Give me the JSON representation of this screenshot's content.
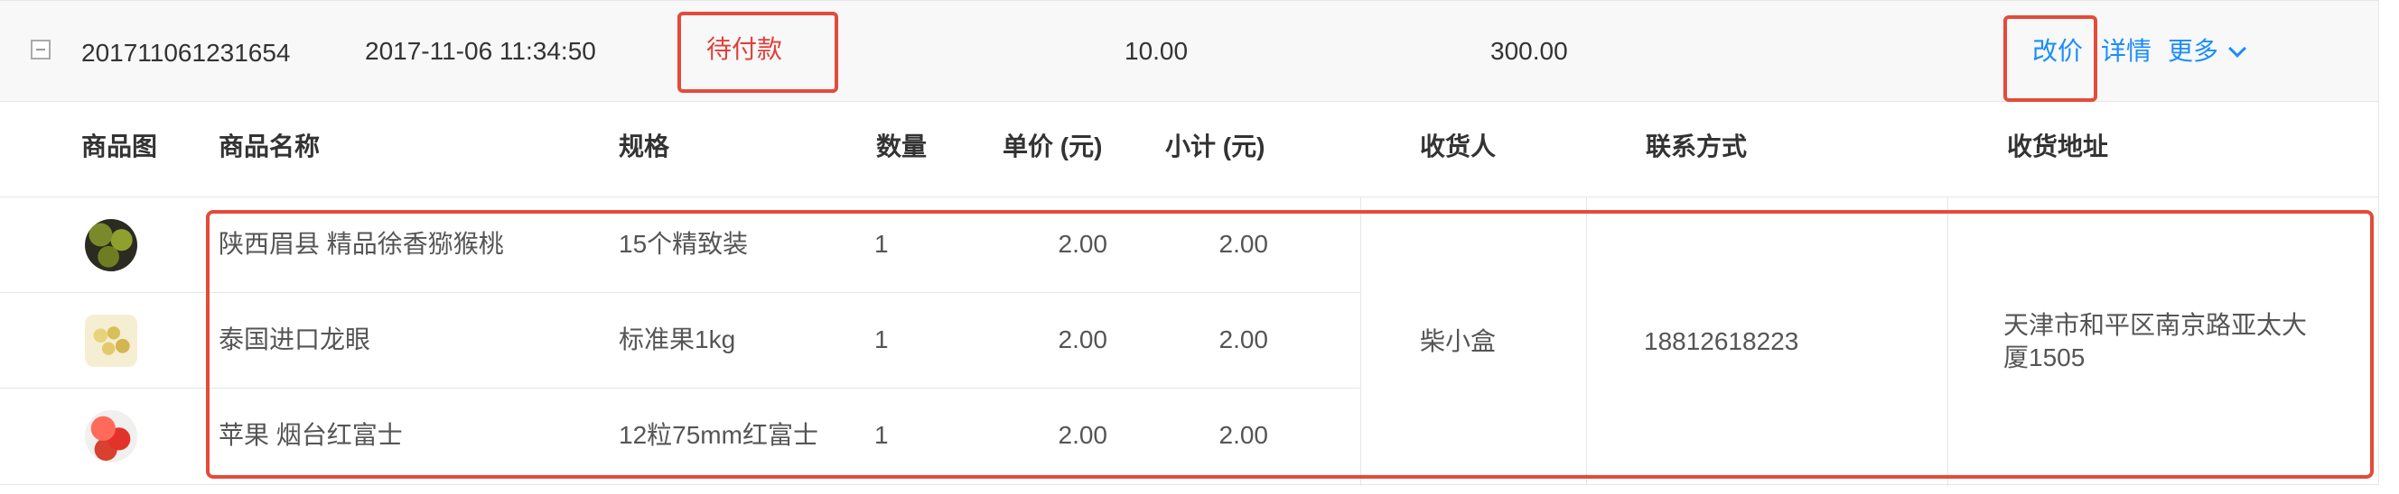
{
  "order": {
    "order_no": "201711061231654",
    "created_at": "2017-11-06 11:34:50",
    "status": "待付款",
    "amount": "10.00",
    "total": "300.00",
    "actions": {
      "change_price": "改价",
      "details": "详情",
      "more": "更多"
    }
  },
  "table": {
    "headers": {
      "image": "商品图",
      "name": "商品名称",
      "spec": "规格",
      "qty": "数量",
      "unit_price": "单价 (元)",
      "subtotal": "小计 (元)",
      "receiver": "收货人",
      "contact": "联系方式",
      "address": "收货地址"
    },
    "items": [
      {
        "thumb": "kiwi-thumbnail",
        "name": "陕西眉县 精品徐香猕猴桃",
        "spec": "15个精致装",
        "qty": "1",
        "unit_price": "2.00",
        "subtotal": "2.00"
      },
      {
        "thumb": "longan-thumbnail",
        "name": "泰国进口龙眼",
        "spec": "标准果1kg",
        "qty": "1",
        "unit_price": "2.00",
        "subtotal": "2.00"
      },
      {
        "thumb": "apple-thumbnail",
        "name": "苹果 烟台红富士",
        "spec": "12粒75mm红富士",
        "qty": "1",
        "unit_price": "2.00",
        "subtotal": "2.00"
      }
    ],
    "receiver": "柴小盒",
    "contact": "18812618223",
    "address_line1": "天津市和平区南京路亚太大",
    "address_line2": "厦1505"
  },
  "colors": {
    "highlight_box": "#e44b3a",
    "status_red": "#e0403a",
    "link_blue": "#1a8cff",
    "summary_bg": "#f8f8f8",
    "border": "#e6e6e6"
  },
  "icons": {
    "collapse": "minus-square-icon",
    "more_dropdown": "chevron-down-icon"
  }
}
